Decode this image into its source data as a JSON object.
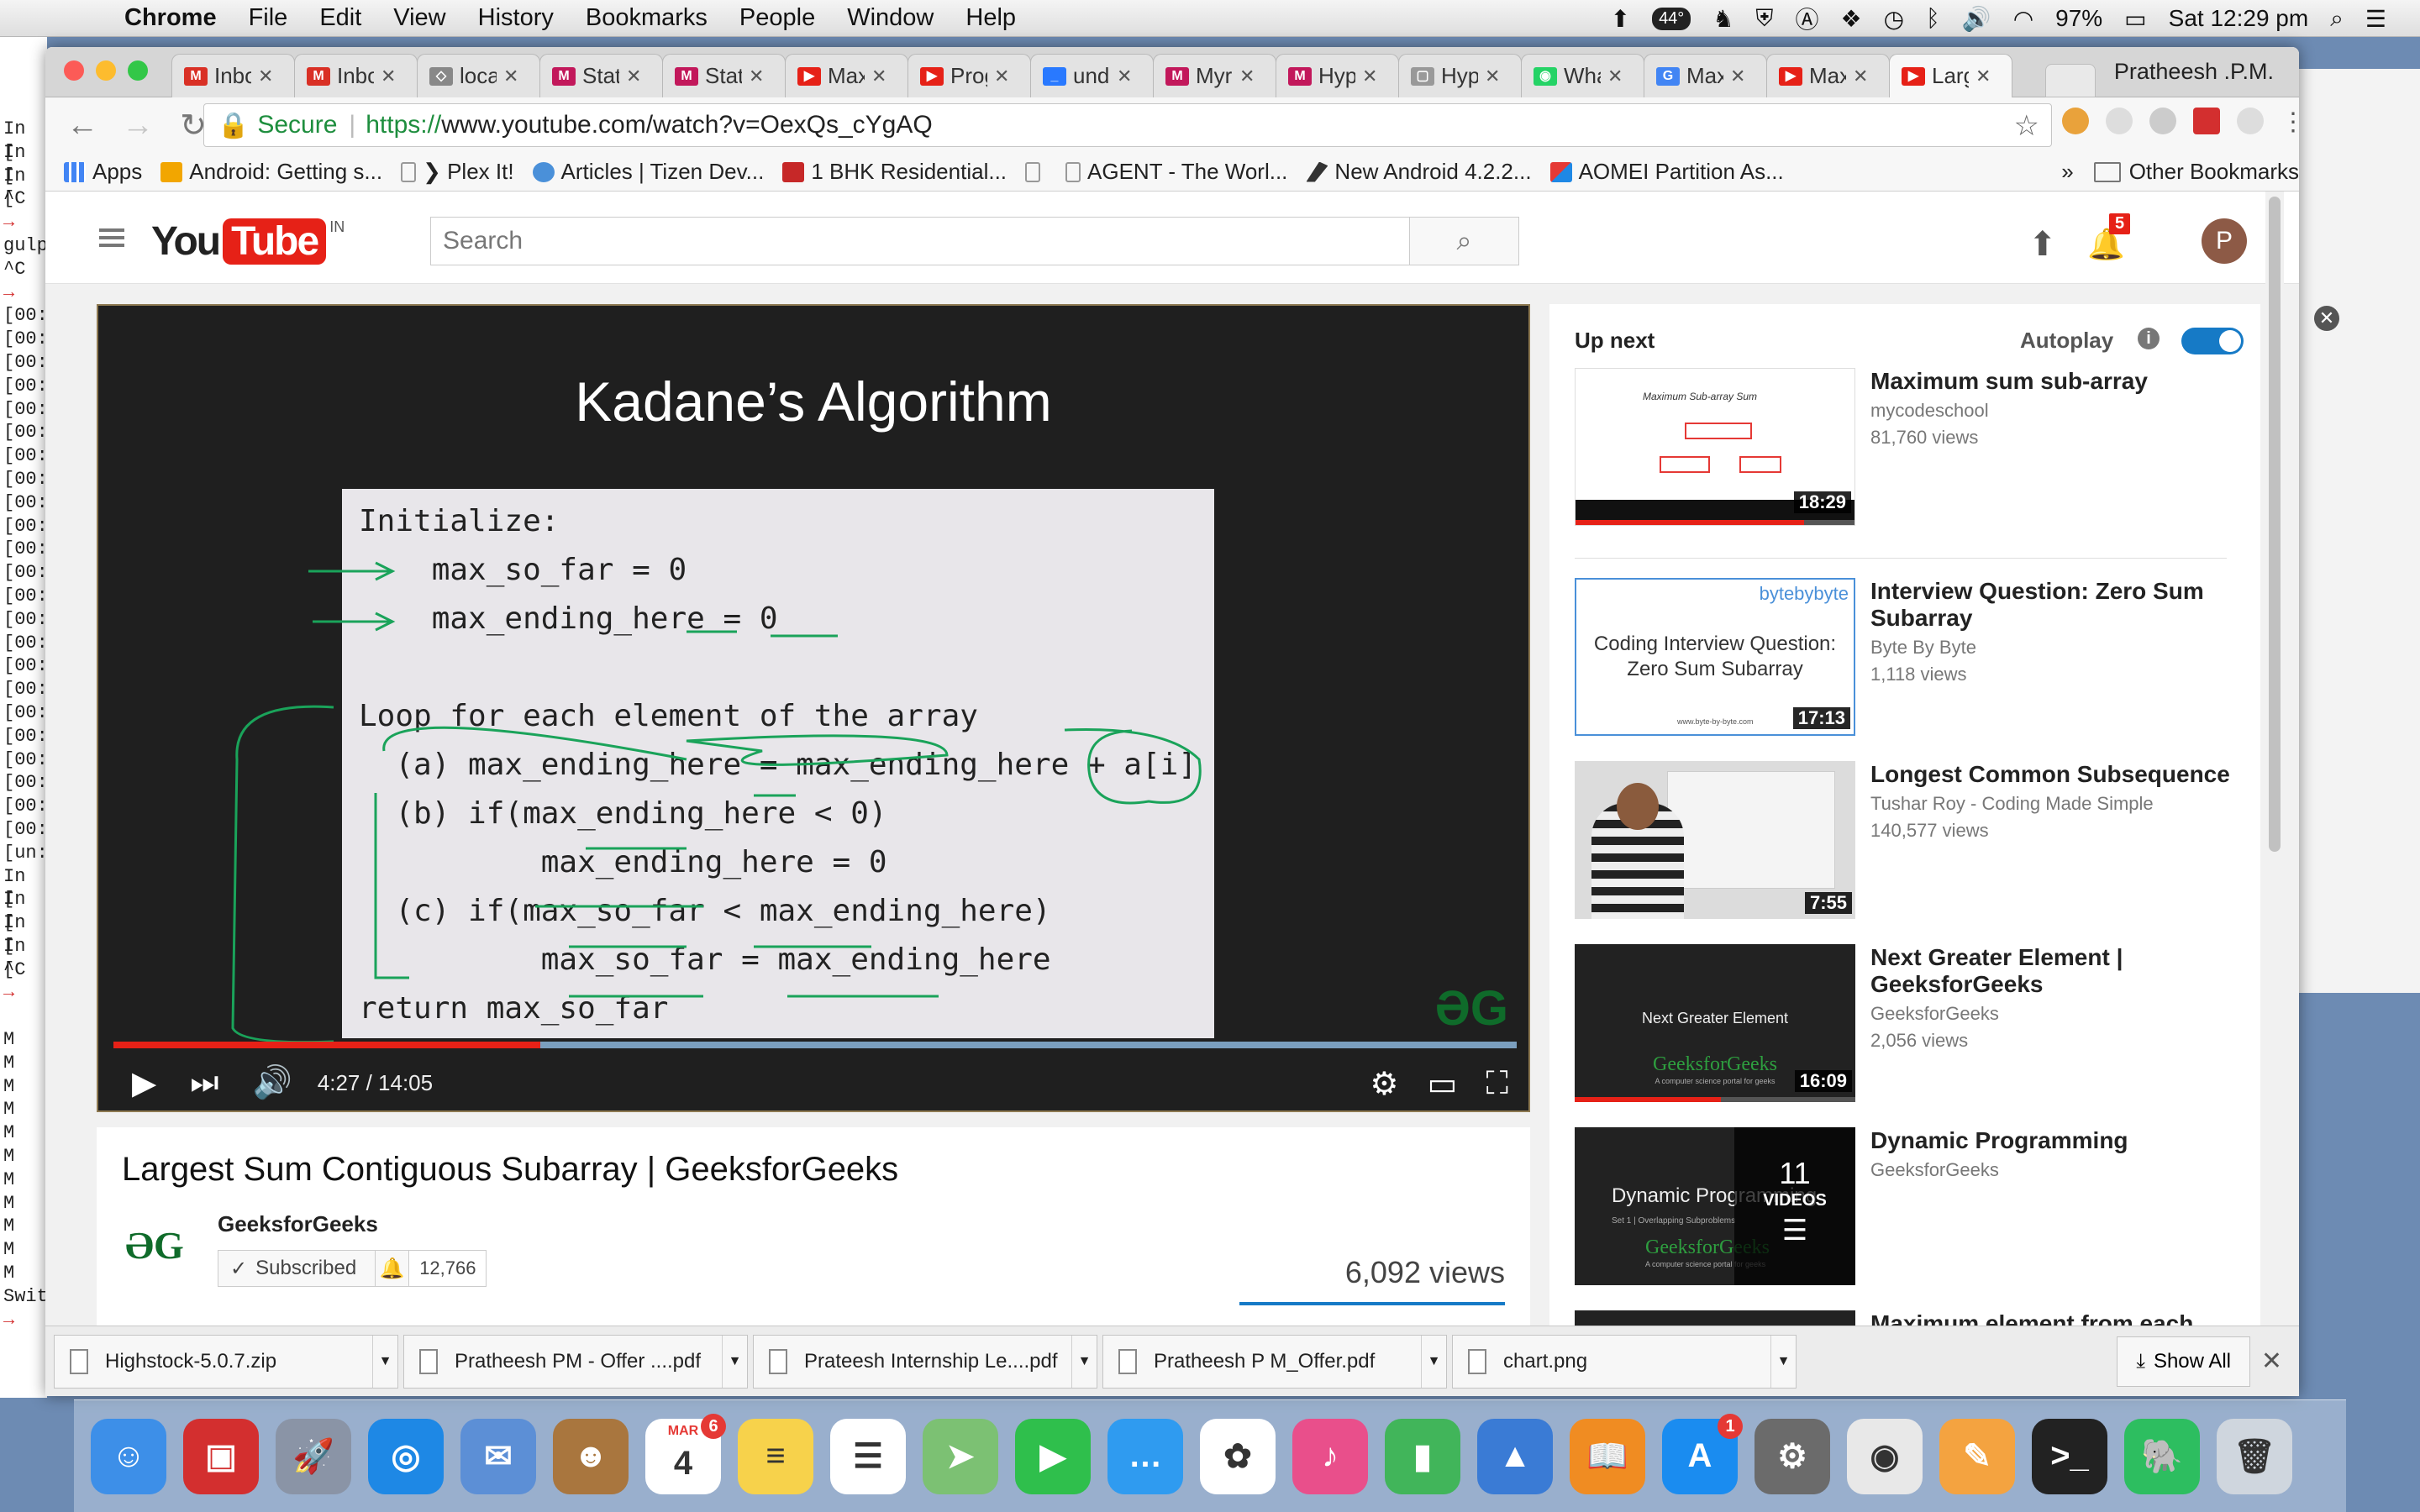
{
  "menubar": {
    "app": "Chrome",
    "items": [
      "File",
      "Edit",
      "View",
      "History",
      "Bookmarks",
      "People",
      "Window",
      "Help"
    ],
    "temperature": "44°",
    "battery": "97%",
    "clock": "Sat 12:29 pm"
  },
  "terminal_lines": [
    "In [",
    "In [",
    "In [",
    "^C",
    "→",
    "gulp",
    "^C",
    "→",
    "[00:",
    "[00:",
    "[00:",
    "[00:",
    "[00:",
    "[00:",
    "[00:",
    "[00:",
    "[00:",
    "[00:",
    "[00:",
    "[00:",
    "[00:",
    "[00:",
    "[00:",
    "[00:",
    "[00:",
    "[00:",
    "[00:",
    "[00:",
    "[00:",
    "[00:",
    "[00:",
    "[un:",
    "In [",
    "In [",
    "In [",
    "In [",
    "^C",
    "→",
    "",
    "M",
    "M",
    "M",
    "M",
    "M",
    "M",
    "M",
    "M",
    "M",
    "M",
    "M",
    "Swit",
    "→"
  ],
  "browser": {
    "profile": "Pratheesh .P.M.",
    "tabs": [
      {
        "title": "Inbox",
        "fav": "M",
        "color": "#d93025"
      },
      {
        "title": "Inbox",
        "fav": "M",
        "color": "#d93025"
      },
      {
        "title": "loca",
        "fav": "◇",
        "color": "#888888"
      },
      {
        "title": "Stat",
        "fav": "M",
        "color": "#c2185b"
      },
      {
        "title": "Stat",
        "fav": "M",
        "color": "#c2185b"
      },
      {
        "title": "Max",
        "fav": "▶",
        "color": "#e62117"
      },
      {
        "title": "Prog",
        "fav": "▶",
        "color": "#e62117"
      },
      {
        "title": "und",
        "fav": "_",
        "color": "#2979ff"
      },
      {
        "title": "Myr",
        "fav": "M",
        "color": "#c2185b"
      },
      {
        "title": "Hyp",
        "fav": "M",
        "color": "#c2185b"
      },
      {
        "title": "Hyp",
        "fav": "▢",
        "color": "#999999"
      },
      {
        "title": "Wha",
        "fav": "◉",
        "color": "#25d366"
      },
      {
        "title": "Max",
        "fav": "G",
        "color": "#4285f4"
      },
      {
        "title": "Max",
        "fav": "▶",
        "color": "#e62117"
      },
      {
        "title": "Larg",
        "fav": "▶",
        "color": "#e62117"
      }
    ],
    "secure_label": "Secure",
    "url_prefix": "https://",
    "url_rest": "www.youtube.com/watch?v=OexQs_cYgAQ",
    "bookmarks": [
      "Apps",
      "Android: Getting s...",
      "❯ Plex It!",
      "Articles | Tizen Dev...",
      "1 BHK Residential...",
      "",
      "AGENT - The Worl...",
      "New Android 4.2.2...",
      "AOMEI Partition As..."
    ],
    "bookmarks_more": "»",
    "other_bookmarks": "Other Bookmarks"
  },
  "youtube": {
    "logo_you": "You",
    "logo_tube": "Tube",
    "logo_region": "IN",
    "search_placeholder": "Search",
    "notifications": "5",
    "avatar_letter": "P",
    "player": {
      "slide_title": "Kadane’s Algorithm",
      "code": [
        "Initialize:",
        "    max_so_far = 0",
        "    max_ending_here = 0",
        "",
        "Loop for each element of the array",
        "  (a) max_ending_here = max_ending_here + a[i]",
        "  (b) if(max_ending_here < 0)",
        "          max_ending_here = 0",
        "  (c) if(max_so_far < max_ending_here)",
        "          max_so_far = max_ending_here",
        "return max_so_far"
      ],
      "watermark": "ƏG",
      "time": "4:27 / 14:05",
      "progress": 0.304
    },
    "video_title": "Largest Sum Contiguous Subarray | GeeksforGeeks",
    "channel_logo": "ƏG",
    "channel": "GeeksforGeeks",
    "subscribed": "Subscribed",
    "subscribers": "12,766",
    "views": "6,092 views",
    "up_next": "Up next",
    "autoplay": "Autoplay",
    "recommendations": [
      {
        "title": "Maximum sum sub-array",
        "channel": "mycodeschool",
        "views": "81,760 views",
        "duration": "18:29",
        "thumb_text": "Maximum Sub-array Sum",
        "progress": 0.82
      },
      {
        "title": "Interview Question: Zero Sum Subarray",
        "channel": "Byte By Byte",
        "views": "1,118 views",
        "duration": "17:13",
        "thumb_text": "Coding Interview Question: Zero Sum Subarray",
        "thumb_brand": "bytebybyte",
        "thumb_url": "www.byte-by-byte.com"
      },
      {
        "title": "Longest Common Subsequence",
        "channel": "Tushar Roy - Coding Made Simple",
        "views": "140,577 views",
        "duration": "7:55",
        "thumb_text": ""
      },
      {
        "title": "Next Greater Element | GeeksforGeeks",
        "channel": "GeeksforGeeks",
        "views": "2,056 views",
        "duration": "16:09",
        "thumb_text": "Next Greater Element",
        "thumb_brand": "GeeksforGeeks",
        "thumb_sub": "A computer science portal for geeks",
        "progress": 0.52
      },
      {
        "title": "Dynamic Programming",
        "channel": "GeeksforGeeks",
        "views": "",
        "duration": "",
        "thumb_text": "Dynamic Programming",
        "thumb_sub2": "Set 1 | Overlapping Subproblems",
        "thumb_brand": "GeeksforGeeks",
        "thumb_sub": "A computer science portal for geeks",
        "playlist_count": "11",
        "playlist_label": "VIDEOS"
      },
      {
        "title": "Maximum element from each",
        "channel": "",
        "views": "",
        "duration": ""
      }
    ]
  },
  "downloads": [
    {
      "name": "Highstock-5.0.7.zip"
    },
    {
      "name": "Pratheesh PM - Offer ....pdf"
    },
    {
      "name": "Prateesh Internship Le....pdf"
    },
    {
      "name": "Pratheesh P M_Offer.pdf"
    },
    {
      "name": "chart.png"
    }
  ],
  "show_all": "Show All",
  "dock": [
    {
      "name": "finder",
      "color": "#3d8fe8",
      "glyph": "☺"
    },
    {
      "name": "security",
      "color": "#d32f2f",
      "glyph": "▣"
    },
    {
      "name": "launchpad",
      "color": "#8a94a6",
      "glyph": "🚀"
    },
    {
      "name": "safari",
      "color": "#1e88e5",
      "glyph": "◎"
    },
    {
      "name": "mail",
      "color": "#5c8fd6",
      "glyph": "✉"
    },
    {
      "name": "contacts",
      "color": "#a9763e",
      "glyph": "☻"
    },
    {
      "name": "calendar",
      "color": "#ffffff",
      "glyph": "4",
      "month": "MAR",
      "badge": "6"
    },
    {
      "name": "notes",
      "color": "#f7d24b",
      "glyph": "≡"
    },
    {
      "name": "reminders",
      "color": "#ffffff",
      "glyph": "☰"
    },
    {
      "name": "maps",
      "color": "#7cc173",
      "glyph": "➤"
    },
    {
      "name": "facetime",
      "color": "#2fbf4c",
      "glyph": "▶"
    },
    {
      "name": "messages",
      "color": "#2f9bf0",
      "glyph": "…"
    },
    {
      "name": "photos",
      "color": "#ffffff",
      "glyph": "✿"
    },
    {
      "name": "itunes",
      "color": "#e94f8b",
      "glyph": "♪"
    },
    {
      "name": "numbers",
      "color": "#41b55a",
      "glyph": "▮"
    },
    {
      "name": "keynote",
      "color": "#3a7bd5",
      "glyph": "▲"
    },
    {
      "name": "ibooks",
      "color": "#f08c22",
      "glyph": "📖"
    },
    {
      "name": "app-store",
      "color": "#1a8cf0",
      "glyph": "A",
      "badge": "1"
    },
    {
      "name": "system-preferences",
      "color": "#6b6b6b",
      "glyph": "⚙"
    },
    {
      "name": "chrome",
      "color": "#e8e8e8",
      "glyph": "◉"
    },
    {
      "name": "pages",
      "color": "#f4a340",
      "glyph": "✎"
    },
    {
      "name": "terminal",
      "color": "#222222",
      "glyph": ">_"
    },
    {
      "name": "evernote",
      "color": "#2dbe60",
      "glyph": "🐘"
    },
    {
      "name": "trash",
      "color": "#cfd6de",
      "glyph": "🗑"
    }
  ]
}
